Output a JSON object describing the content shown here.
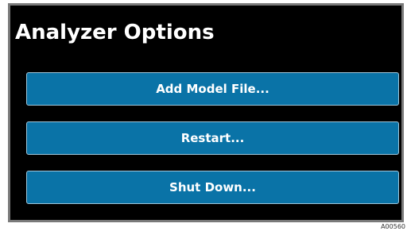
{
  "panel": {
    "title": "Analyzer Options"
  },
  "buttons": {
    "add_model_file": "Add Model File...",
    "restart": "Restart...",
    "shut_down": "Shut Down..."
  },
  "colors": {
    "panel_background": "#000000",
    "panel_border": "#7a7a7a",
    "button_fill": "#0a73a7",
    "button_border": "#9ec7dc",
    "text": "#ffffff"
  },
  "figure_id": "A00560"
}
